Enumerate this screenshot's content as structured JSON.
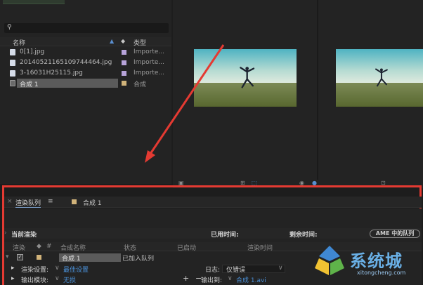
{
  "colors": {
    "highlight": "#e43a32",
    "link": "#4a8fd6",
    "comp_label": "#d1b37a",
    "footage_label": "#b7a3d9"
  },
  "project": {
    "search_icon": "magnifier-icon",
    "header": {
      "name": "名称",
      "type": "类型"
    },
    "items": [
      {
        "name": "0[1].jpg",
        "type": "Importe...",
        "label_color": "#b7a3d9"
      },
      {
        "name": "20140521165109744464.jpg",
        "type": "Importe...",
        "label_color": "#b7a3d9"
      },
      {
        "name": "3-16031H25115.jpg",
        "type": "Importe...",
        "label_color": "#b7a3d9"
      },
      {
        "name": "合成 1",
        "type": "合成",
        "label_color": "#d1b37a"
      }
    ]
  },
  "render_queue": {
    "tabs": {
      "queue": "渲染队列",
      "comp": "合成 1"
    },
    "status": {
      "current": "当前渲染",
      "elapsed": "已用时间:",
      "remaining": "剩余时间:",
      "ame_button": "AME 中的队列"
    },
    "columns": {
      "render": "渲染",
      "num": "#",
      "comp_name": "合成名称",
      "status": "状态",
      "started": "已启动",
      "render_time": "渲染时间"
    },
    "item": {
      "comp_name": "合成 1",
      "status": "已加入队列"
    },
    "settings": {
      "render_label": "渲染设置:",
      "render_value": "最佳设置",
      "log_label": "日志:",
      "log_value": "仅错误",
      "output_module_label": "输出模块:",
      "output_module_value": "无损",
      "output_to_label": "输出到:",
      "output_to_value": "合成 1.avi"
    }
  },
  "watermark": {
    "main": "系统城",
    "sub": "xitongcheng.com"
  }
}
